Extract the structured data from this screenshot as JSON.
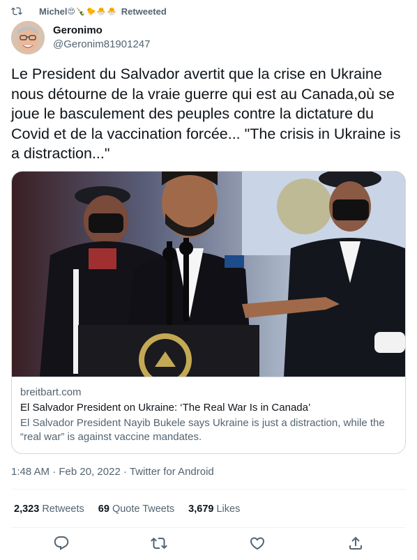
{
  "retweet_bar": {
    "name": "Michel",
    "emojis": "😍🍾🐤🐣🐣",
    "suffix": "Retweeted"
  },
  "author": {
    "display_name": "Geronimo",
    "handle": "@Geronim81901247"
  },
  "tweet": {
    "text": "Le President du Salvador avertit que la crise en Ukraine nous détourne de la vraie guerre qui est au Canada,où se joue le basculement des peuples contre la dictature du Covid et de la vaccination forcée... \"The crisis in Ukraine is a distraction...\""
  },
  "card": {
    "domain": "breitbart.com",
    "title": "El Salvador President on Ukraine: ‘The Real War Is in Canada’",
    "description": "El Salvador President Nayib Bukele says Ukraine is just a distraction, while the “real war” is against vaccine mandates."
  },
  "meta": {
    "time": "1:48 AM",
    "date": "Feb 20, 2022",
    "source": "Twitter for Android",
    "separator": "·"
  },
  "stats": {
    "retweets_count": "2,323",
    "retweets_label": "Retweets",
    "quotes_count": "69",
    "quotes_label": "Quote Tweets",
    "likes_count": "3,679",
    "likes_label": "Likes"
  },
  "colors": {
    "text_primary": "#0f1419",
    "text_secondary": "#536471",
    "border": "#cfd9de",
    "divider": "#eff3f4"
  }
}
